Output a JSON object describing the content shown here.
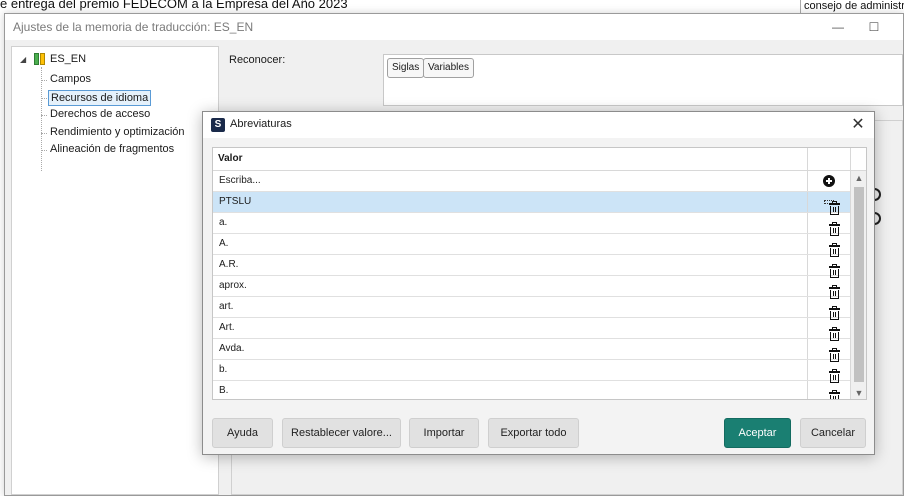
{
  "background": {
    "top_text": "e entrega del premio FEDECOM a la Empresa del Año 2023",
    "right_text": "consejo de administrac"
  },
  "main_window": {
    "title": "Ajustes de la memoria de traducción: ES_EN",
    "minimize_glyph": "—",
    "maximize_glyph": "☐",
    "tree": {
      "root_label": "ES_EN",
      "toggle_glyph": "◢",
      "items": [
        {
          "label": "Campos"
        },
        {
          "label": "Recursos de idioma",
          "selected": true
        },
        {
          "label": "Derechos de acceso"
        },
        {
          "label": "Rendimiento y optimización"
        },
        {
          "label": "Alineación de fragmentos"
        }
      ]
    },
    "reconocer_label": "Reconocer:",
    "reconocer_tags": [
      "Siglas",
      "Variables"
    ]
  },
  "dialog": {
    "title": "Abreviaturas",
    "app_icon_letter": "S",
    "close_glyph": "✕",
    "column_header": "Valor",
    "input_placeholder": "Escriba...",
    "rows": [
      "PTSLU",
      "a.",
      "A.",
      "A.R.",
      "aprox.",
      "art.",
      "Art.",
      "Avda.",
      "b.",
      "B."
    ],
    "selected_row": "PTSLU",
    "scroll_up_glyph": "▲",
    "scroll_down_glyph": "▼",
    "buttons": {
      "help": "Ayuda",
      "reset": "Restablecer valore...",
      "import": "Importar",
      "export_all": "Exportar todo",
      "accept": "Aceptar",
      "cancel": "Cancelar"
    },
    "colors": {
      "accept": "#1a7f72",
      "selection": "#cce4f7"
    }
  }
}
